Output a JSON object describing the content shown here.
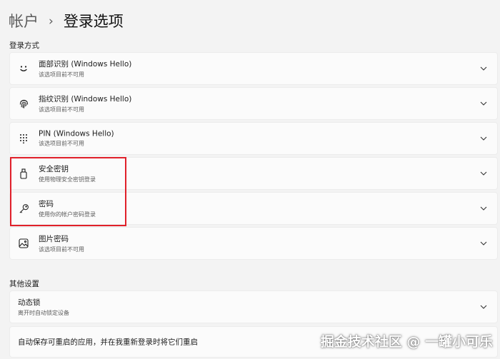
{
  "header": {
    "parent": "帐户",
    "separator": "›",
    "current": "登录选项"
  },
  "sections": {
    "signin_methods": "登录方式",
    "other_settings": "其他设置"
  },
  "methods": [
    {
      "icon": "smiley-face-icon",
      "title": "面部识别 (Windows Hello)",
      "subtitle": "该选项目前不可用"
    },
    {
      "icon": "fingerprint-icon",
      "title": "指纹识别 (Windows Hello)",
      "subtitle": "该选项目前不可用"
    },
    {
      "icon": "keypad-icon",
      "title": "PIN (Windows Hello)",
      "subtitle": "该选项目前不可用"
    },
    {
      "icon": "usb-key-icon",
      "title": "安全密钥",
      "subtitle": "使用物理安全密钥登录"
    },
    {
      "icon": "key-icon",
      "title": "密码",
      "subtitle": "使用你的帐户密码登录"
    },
    {
      "icon": "picture-icon",
      "title": "图片密码",
      "subtitle": "该选项目前不可用"
    }
  ],
  "other": [
    {
      "title": "动态锁",
      "subtitle": "离开时自动锁定设备"
    },
    {
      "title": "自动保存可重启的应用，并在我重新登录时将它们重启"
    }
  ],
  "watermark": "掘金技术社区 @ 一罐小可乐",
  "colors": {
    "background": "#f3f3f3",
    "card": "#fbfbfb",
    "highlight": "#e0202a"
  }
}
